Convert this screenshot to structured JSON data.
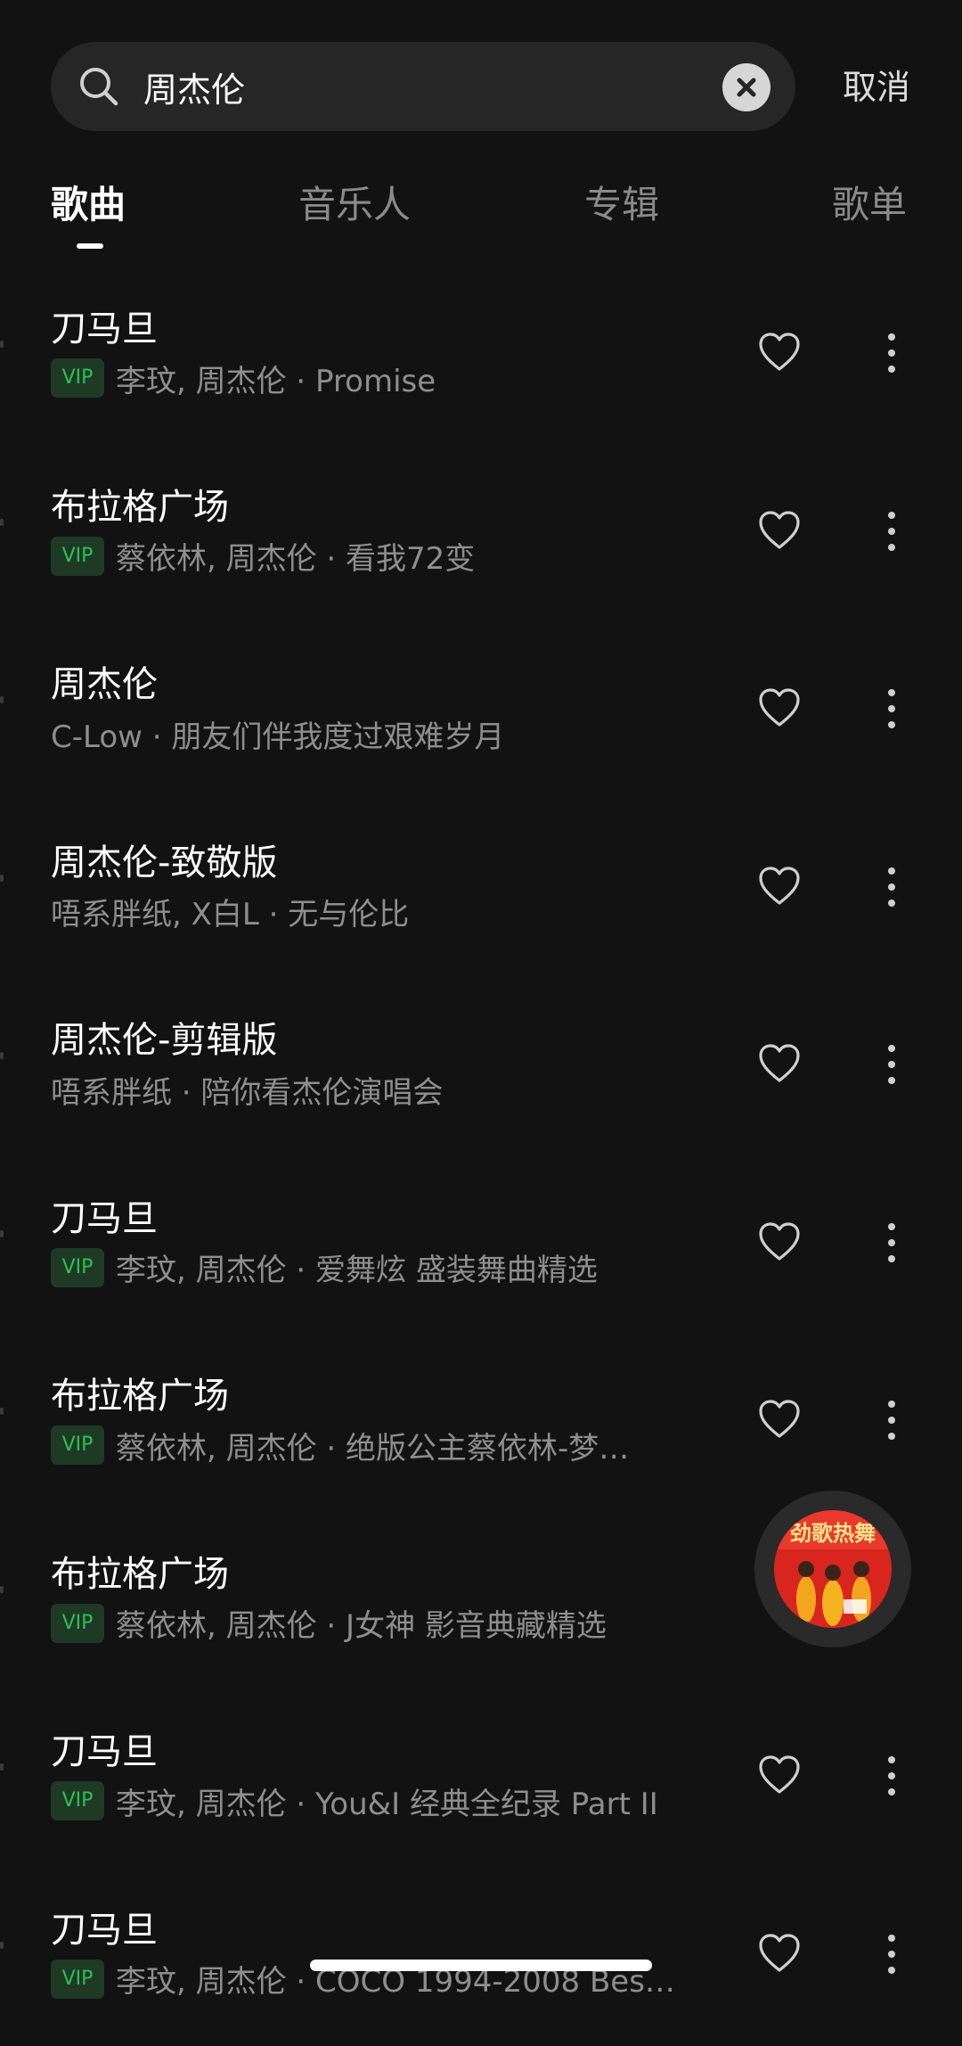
{
  "search": {
    "query": "周杰伦",
    "cancel_label": "取消"
  },
  "tabs": [
    {
      "label": "歌曲",
      "active": true
    },
    {
      "label": "音乐人",
      "active": false
    },
    {
      "label": "专辑",
      "active": false
    },
    {
      "label": "歌单",
      "active": false
    }
  ],
  "songs": [
    {
      "title": "刀马旦",
      "vip": true,
      "vip_label": "VIP",
      "meta": "李玟, 周杰伦 · Promise"
    },
    {
      "title": "布拉格广场",
      "vip": true,
      "vip_label": "VIP",
      "meta": "蔡依林, 周杰伦 · 看我72变"
    },
    {
      "title": "周杰伦",
      "vip": false,
      "meta": "C-Low · 朋友们伴我度过艰难岁月"
    },
    {
      "title": "周杰伦-致敬版",
      "vip": false,
      "meta": "唔系胖纸, X白L · 无与伦比"
    },
    {
      "title": "周杰伦-剪辑版",
      "vip": false,
      "meta": "唔系胖纸 · 陪你看杰伦演唱会"
    },
    {
      "title": "刀马旦",
      "vip": true,
      "vip_label": "VIP",
      "meta": "李玟, 周杰伦 · 爱舞炫 盛装舞曲精选"
    },
    {
      "title": "布拉格广场",
      "vip": true,
      "vip_label": "VIP",
      "meta": "蔡依林, 周杰伦 · 绝版公主蔡依林-梦…"
    },
    {
      "title": "布拉格广场",
      "vip": true,
      "vip_label": "VIP",
      "meta": "蔡依林, 周杰伦 · J女神 影音典藏精选"
    },
    {
      "title": "刀马旦",
      "vip": true,
      "vip_label": "VIP",
      "meta": "李玟, 周杰伦 · You&I 经典全纪录 Part II"
    },
    {
      "title": "刀马旦",
      "vip": true,
      "vip_label": "VIP",
      "meta": "李玟, 周杰伦 · COCO 1994-2008 Bes…"
    }
  ],
  "mini_player": {
    "cover_text": "劲歌热舞",
    "cover_color": "#d8261f"
  },
  "colors": {
    "background": "#121212",
    "vip_green": "#2fbf57",
    "secondary_text": "#8e8e8e"
  },
  "icons": {
    "search": "search-icon",
    "clear": "close-circle-icon",
    "favorite": "heart-outline-icon",
    "more": "more-vertical-icon"
  }
}
